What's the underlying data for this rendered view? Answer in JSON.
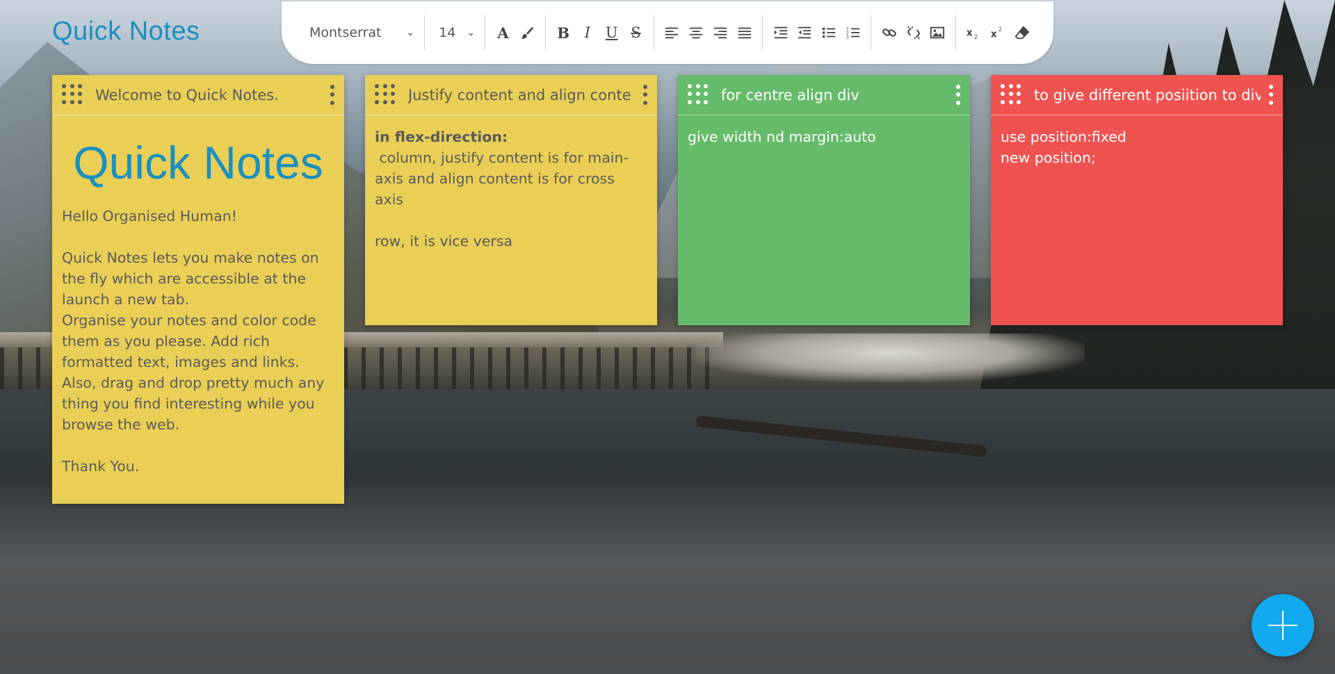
{
  "app": {
    "title": "Quick Notes"
  },
  "toolbar": {
    "font_family": "Montserrat",
    "font_size": "14",
    "buttons": [
      "text-color",
      "background-color",
      "bold",
      "italic",
      "underline",
      "strikethrough",
      "align-left",
      "align-center",
      "align-right",
      "align-justify",
      "indent",
      "outdent",
      "bullet-list",
      "numbered-list",
      "link",
      "unlink",
      "image",
      "subscript",
      "superscript",
      "clear-format"
    ]
  },
  "notes": [
    {
      "title": "Welcome to Quick Notes.",
      "color": "#e9cf56",
      "brand": "Quick Notes",
      "paragraphs": {
        "greeting": "Hello Organised Human!",
        "p1": "Quick Notes lets you make notes on the fly which are accessible at the launch a new tab.",
        "p2": "Organise your notes and color code them as you please. Add rich formatted text, images and links.",
        "p3": "Also, drag and drop pretty much any thing you find interesting while you browse the web.",
        "thanks": "Thank You."
      }
    },
    {
      "title": "Justify content and align conte",
      "color": "#e9cf56",
      "lines": {
        "heading": "in flex-direction:",
        "l1": " column, justify content is for main-axis and align content is for cross axis",
        "l2": "row, it is vice versa"
      }
    },
    {
      "title": "for centre align div",
      "color": "#66bb6a",
      "lines": {
        "l1": "give width nd margin:auto"
      }
    },
    {
      "title": "to give different posiition to div",
      "color": "#ef5350",
      "lines": {
        "l1": "use position:fixed",
        "l2": "new position;"
      }
    }
  ],
  "fab": {
    "icon": "plus-icon",
    "color": "#11aaf0"
  }
}
